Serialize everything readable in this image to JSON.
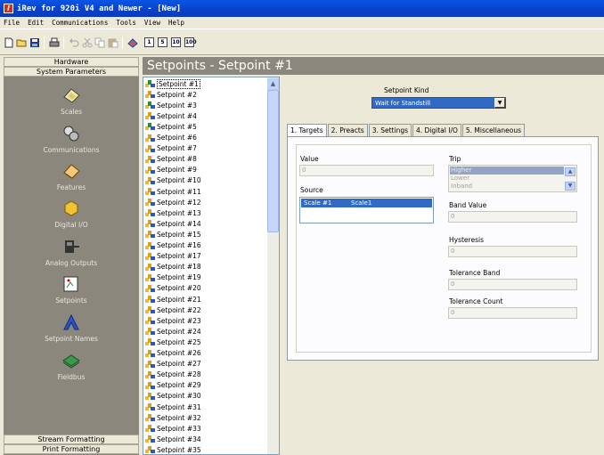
{
  "window": {
    "title": "iRev for 920i V4 and Newer - [New]",
    "icon_letter": "I"
  },
  "menu": [
    "File",
    "Edit",
    "Communications",
    "Tools",
    "View",
    "Help"
  ],
  "toolbar": {
    "icons": [
      "new-file-icon",
      "open-folder-icon",
      "save-icon",
      "print-icon",
      "undo-icon",
      "cut-icon",
      "copy-icon",
      "paste-icon",
      "scale-icon"
    ],
    "num_buttons": [
      "1",
      "5",
      "10",
      "100"
    ]
  },
  "nav": {
    "header_top": "Hardware",
    "header_second": "System Parameters",
    "items": [
      {
        "label": "Scales",
        "icon": "scales-icon"
      },
      {
        "label": "Communications",
        "icon": "communications-icon"
      },
      {
        "label": "Features",
        "icon": "features-icon"
      },
      {
        "label": "Digital I/O",
        "icon": "digital-io-icon"
      },
      {
        "label": "Analog Outputs",
        "icon": "analog-outputs-icon"
      },
      {
        "label": "Setpoints",
        "icon": "setpoints-icon"
      },
      {
        "label": "Setpoint Names",
        "icon": "setpoint-names-icon"
      },
      {
        "label": "Fieldbus",
        "icon": "fieldbus-icon"
      }
    ],
    "footer_items": [
      "Stream Formatting",
      "Print Formatting"
    ]
  },
  "banner": {
    "title": "Setpoints - Setpoint #1"
  },
  "setpoints": [
    "Setpoint #1",
    "Setpoint #2",
    "Setpoint #3",
    "Setpoint #4",
    "Setpoint #5",
    "Setpoint #6",
    "Setpoint #7",
    "Setpoint #8",
    "Setpoint #9",
    "Setpoint #10",
    "Setpoint #11",
    "Setpoint #12",
    "Setpoint #13",
    "Setpoint #14",
    "Setpoint #15",
    "Setpoint #16",
    "Setpoint #17",
    "Setpoint #18",
    "Setpoint #19",
    "Setpoint #20",
    "Setpoint #21",
    "Setpoint #22",
    "Setpoint #23",
    "Setpoint #24",
    "Setpoint #25",
    "Setpoint #26",
    "Setpoint #27",
    "Setpoint #28",
    "Setpoint #29",
    "Setpoint #30",
    "Setpoint #31",
    "Setpoint #32",
    "Setpoint #33",
    "Setpoint #34",
    "Setpoint #35"
  ],
  "selected_setpoint": "Setpoint #1",
  "setpoint_kind": {
    "label": "Setpoint Kind",
    "value": "Wait for Standstill"
  },
  "tabs": [
    "1. Targets",
    "2. Preacts",
    "3. Settings",
    "4. Digital I/O",
    "5. Miscellaneous"
  ],
  "active_tab": "1. Targets",
  "targets": {
    "value_label": "Value",
    "value": "0",
    "source_label": "Source",
    "source_rows": [
      {
        "scale": "Scale #1",
        "name": "Scale1"
      }
    ],
    "trip_label": "Trip",
    "trip_options": [
      "Higher",
      "Lower",
      "Inband"
    ],
    "trip_selected": "Higher",
    "band_value_label": "Band Value",
    "band_value": "0",
    "hysteresis_label": "Hysteresis",
    "hysteresis": "0",
    "tolerance_band_label": "Tolerance Band",
    "tolerance_band": "0",
    "tolerance_count_label": "Tolerance Count",
    "tolerance_count": "0"
  }
}
